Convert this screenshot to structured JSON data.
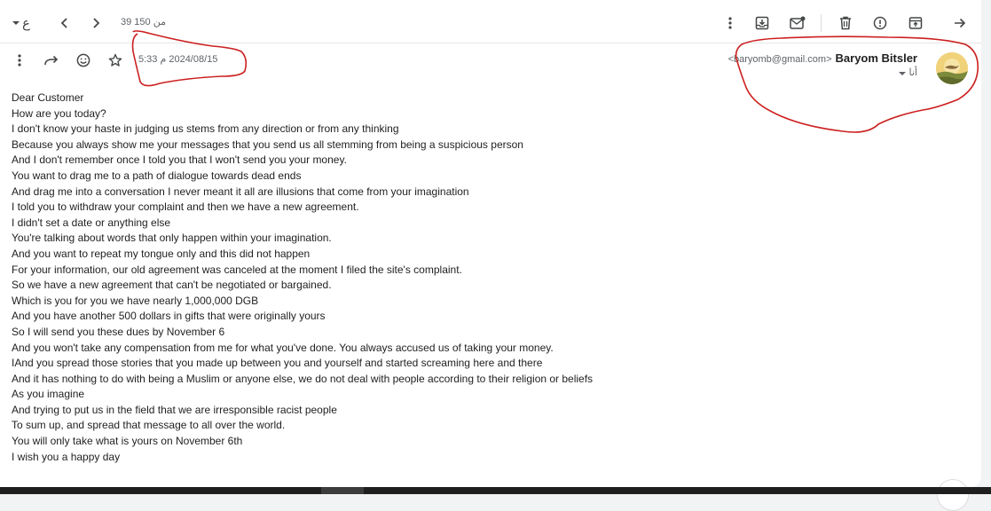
{
  "toolbar": {
    "language_label": "ع",
    "pager": "39 من 150",
    "icons": [
      "chevron-down-icon",
      "chevron-left-icon",
      "chevron-right-icon",
      "more-vert-icon",
      "move-to-inbox-icon",
      "mark-unread-icon",
      "trash-icon",
      "report-spam-icon",
      "archive-icon",
      "arrow-forward-icon"
    ]
  },
  "message_header": {
    "date": "5:33 م ‎2024/08/15",
    "icons": [
      "more-vert-icon",
      "forward-icon",
      "emoji-icon",
      "star-icon"
    ],
    "sender_name": "Baryom Bitsler",
    "sender_email": "<baryomb@gmail.com>",
    "recipient": "أنا"
  },
  "body": {
    "lines": [
      "Dear Customer",
      "How are you today?",
      "I don't know your haste in judging us stems from any direction or from any thinking",
      "Because you always show me your messages that you send us all stemming from being a suspicious person",
      "And I don't remember once I told you that I won't send you your money.",
      "You want to drag me to a path of dialogue towards dead ends",
      "And drag me into a conversation I never meant it all are illusions that come from your imagination",
      "I told you to withdraw your complaint and then we have a new agreement.",
      "I didn't set a date or anything else",
      "You're talking about words that only happen within your imagination.",
      "And you want to repeat my tongue only and this did not happen",
      "For your information, our old agreement was canceled at the moment I filed the site's complaint.",
      "So we have a new agreement that can't be negotiated or bargained.",
      "Which is you for you we have nearly 1,000,000 DGB",
      "And you have another 500 dollars in gifts that were originally yours",
      "So I will send you these dues by November 6",
      "And you won't take any compensation from me for what you've done. You always accused us of taking your money.",
      "IAnd you spread those stories that you made up between you and yourself and started screaming here and there",
      "And it has nothing to do with being a Muslim or anyone else, we do not deal with people according to their religion or beliefs",
      "As you imagine",
      "And trying to put us in the field that we are irresponsible racist people",
      "To sum up, and spread that message to all over the world.",
      "You will only take what is yours on November 6th",
      "I wish you a happy day"
    ]
  },
  "colors": {
    "annotation": "#cc1f1f",
    "icon": "#444746",
    "text": "#1f1f1f"
  }
}
